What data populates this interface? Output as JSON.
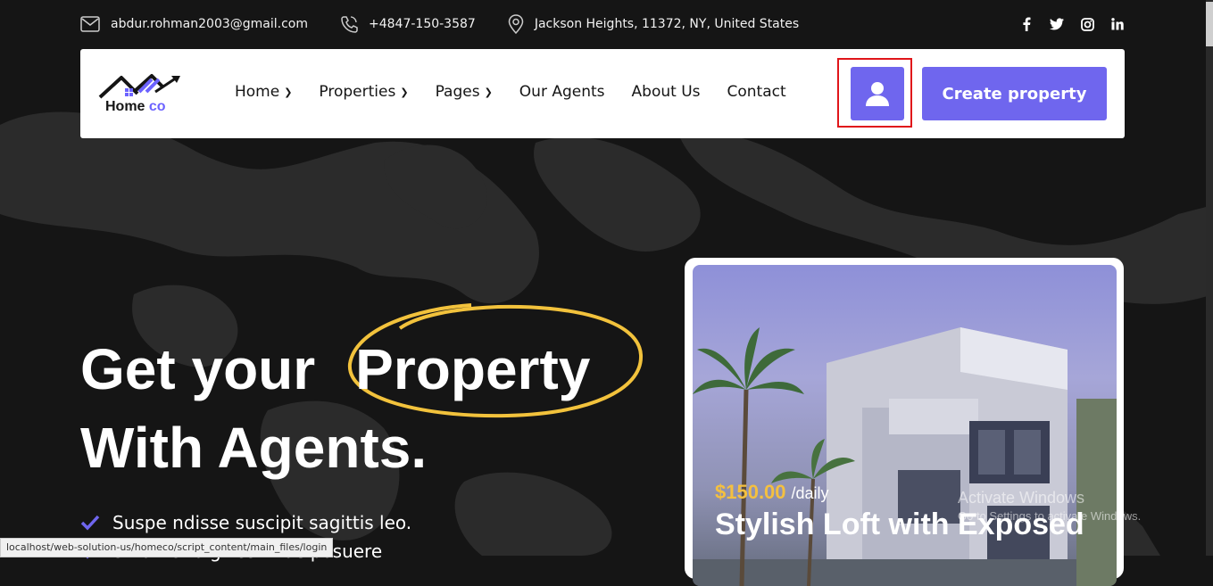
{
  "topbar": {
    "email": "abdur.rohman2003@gmail.com",
    "phone": "+4847-150-3587",
    "address": "Jackson Heights, 11372, NY, United States",
    "social": [
      "facebook-icon",
      "twitter-icon",
      "instagram-icon",
      "linkedin-icon"
    ]
  },
  "navbar": {
    "logo_text_main": "Home",
    "logo_text_accent": "co",
    "menu": [
      {
        "label": "Home",
        "dropdown": true
      },
      {
        "label": "Properties",
        "dropdown": true
      },
      {
        "label": "Pages",
        "dropdown": true
      },
      {
        "label": "Our Agents",
        "dropdown": false
      },
      {
        "label": "About Us",
        "dropdown": false
      },
      {
        "label": "Contact",
        "dropdown": false
      }
    ],
    "create_label": "Create property"
  },
  "hero": {
    "line1_a": "Get your",
    "line1_b": "Property",
    "line2": "With Agents.",
    "bullets": [
      "Suspe ndisse suscipit sagittis leo.",
      "Sit amet dignissim ac posuere"
    ]
  },
  "card": {
    "price": "$150.00",
    "period": "/daily",
    "title": "Stylish Loft with Exposed"
  },
  "watermark": {
    "line1": "Activate Windows",
    "line2": "Go to Settings to activate Windows."
  },
  "status_url": "localhost/web-solution-us/homeco/script_content/main_files/login",
  "colors": {
    "accent": "#6f66ee",
    "highlight": "#e0161a",
    "gold": "#f4c040",
    "background": "#151515"
  }
}
